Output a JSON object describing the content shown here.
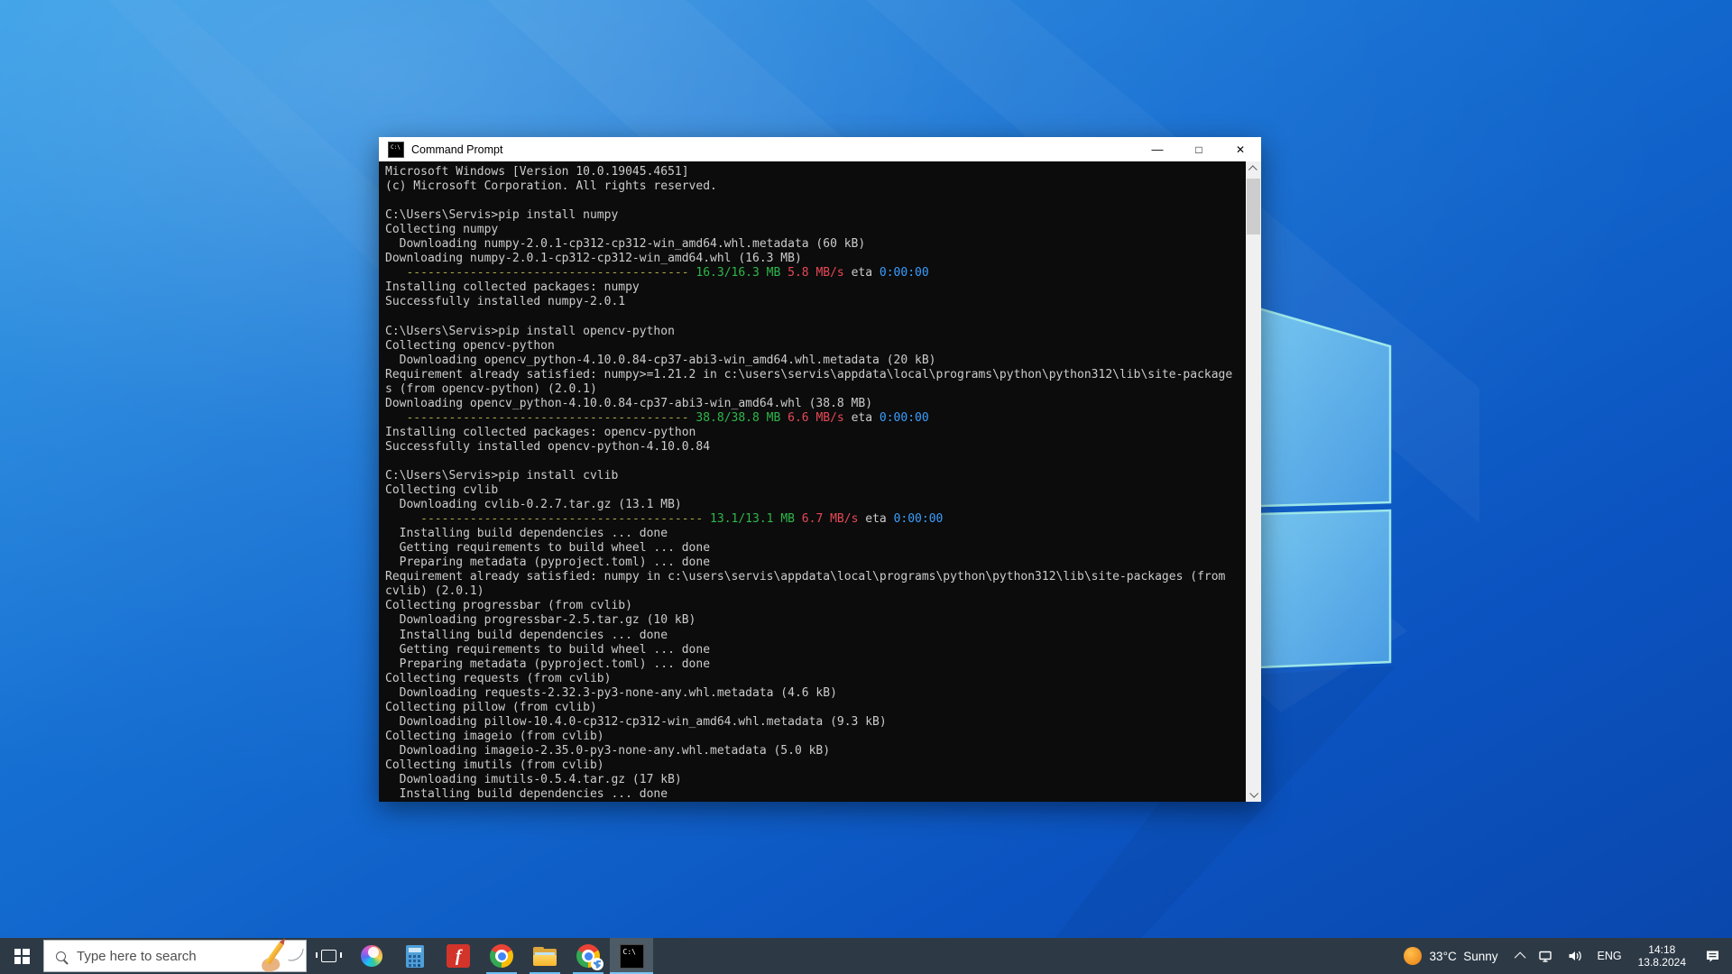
{
  "colors": {
    "term_bg": "#0c0c0c",
    "term_fg": "#cccccc",
    "ansi_yellow": "#a6a64f",
    "ansi_green": "#2eb849",
    "ansi_red": "#e74856",
    "ansi_blue": "#3b9eff",
    "titlebar_bg": "#ffffff",
    "taskbar_bg": "#2d3a46",
    "accent": "#6cc1f5"
  },
  "window": {
    "title": "Command Prompt",
    "icon_label": "C:\\",
    "controls": {
      "minimize": "—",
      "maximize": "□",
      "close": "✕"
    }
  },
  "terminal": {
    "lines": [
      "Microsoft Windows [Version 10.0.19045.4651]",
      "(c) Microsoft Corporation. All rights reserved.",
      "",
      "C:\\Users\\Servis>pip install numpy",
      "Collecting numpy",
      "  Downloading numpy-2.0.1-cp312-cp312-win_amd64.whl.metadata (60 kB)",
      "Downloading numpy-2.0.1-cp312-cp312-win_amd64.whl (16.3 MB)",
      [
        [
          "d",
          "   "
        ],
        [
          "y",
          "----------------------------------------"
        ],
        [
          "d",
          " "
        ],
        [
          "g",
          "16.3/16.3 MB"
        ],
        [
          "d",
          " "
        ],
        [
          "r",
          "5.8 MB/s"
        ],
        [
          "d",
          " eta "
        ],
        [
          "b",
          "0:00:00"
        ]
      ],
      "Installing collected packages: numpy",
      "Successfully installed numpy-2.0.1",
      "",
      "C:\\Users\\Servis>pip install opencv-python",
      "Collecting opencv-python",
      "  Downloading opencv_python-4.10.0.84-cp37-abi3-win_amd64.whl.metadata (20 kB)",
      "Requirement already satisfied: numpy>=1.21.2 in c:\\users\\servis\\appdata\\local\\programs\\python\\python312\\lib\\site-package",
      "s (from opencv-python) (2.0.1)",
      "Downloading opencv_python-4.10.0.84-cp37-abi3-win_amd64.whl (38.8 MB)",
      [
        [
          "d",
          "   "
        ],
        [
          "y",
          "----------------------------------------"
        ],
        [
          "d",
          " "
        ],
        [
          "g",
          "38.8/38.8 MB"
        ],
        [
          "d",
          " "
        ],
        [
          "r",
          "6.6 MB/s"
        ],
        [
          "d",
          " eta "
        ],
        [
          "b",
          "0:00:00"
        ]
      ],
      "Installing collected packages: opencv-python",
      "Successfully installed opencv-python-4.10.0.84",
      "",
      "C:\\Users\\Servis>pip install cvlib",
      "Collecting cvlib",
      "  Downloading cvlib-0.2.7.tar.gz (13.1 MB)",
      [
        [
          "d",
          "     "
        ],
        [
          "y",
          "----------------------------------------"
        ],
        [
          "d",
          " "
        ],
        [
          "g",
          "13.1/13.1 MB"
        ],
        [
          "d",
          " "
        ],
        [
          "r",
          "6.7 MB/s"
        ],
        [
          "d",
          " eta "
        ],
        [
          "b",
          "0:00:00"
        ]
      ],
      "  Installing build dependencies ... done",
      "  Getting requirements to build wheel ... done",
      "  Preparing metadata (pyproject.toml) ... done",
      "Requirement already satisfied: numpy in c:\\users\\servis\\appdata\\local\\programs\\python\\python312\\lib\\site-packages (from",
      "cvlib) (2.0.1)",
      "Collecting progressbar (from cvlib)",
      "  Downloading progressbar-2.5.tar.gz (10 kB)",
      "  Installing build dependencies ... done",
      "  Getting requirements to build wheel ... done",
      "  Preparing metadata (pyproject.toml) ... done",
      "Collecting requests (from cvlib)",
      "  Downloading requests-2.32.3-py3-none-any.whl.metadata (4.6 kB)",
      "Collecting pillow (from cvlib)",
      "  Downloading pillow-10.4.0-cp312-cp312-win_amd64.whl.metadata (9.3 kB)",
      "Collecting imageio (from cvlib)",
      "  Downloading imageio-2.35.0-py3-none-any.whl.metadata (5.0 kB)",
      "Collecting imutils (from cvlib)",
      "  Downloading imutils-0.5.4.tar.gz (17 kB)",
      "  Installing build dependencies ... done"
    ]
  },
  "taskbar": {
    "search_placeholder": "Type here to search",
    "apps": [
      "start",
      "search",
      "task-view",
      "copilot",
      "calculator",
      "f-app",
      "chrome",
      "file-explorer",
      "chrome-dino",
      "command-prompt"
    ],
    "cmd_icon_label": "C:\\",
    "tray": {
      "temperature": "33°C",
      "condition": "Sunny",
      "language": "ENG",
      "time": "14:18",
      "date": "13.8.2024"
    }
  }
}
